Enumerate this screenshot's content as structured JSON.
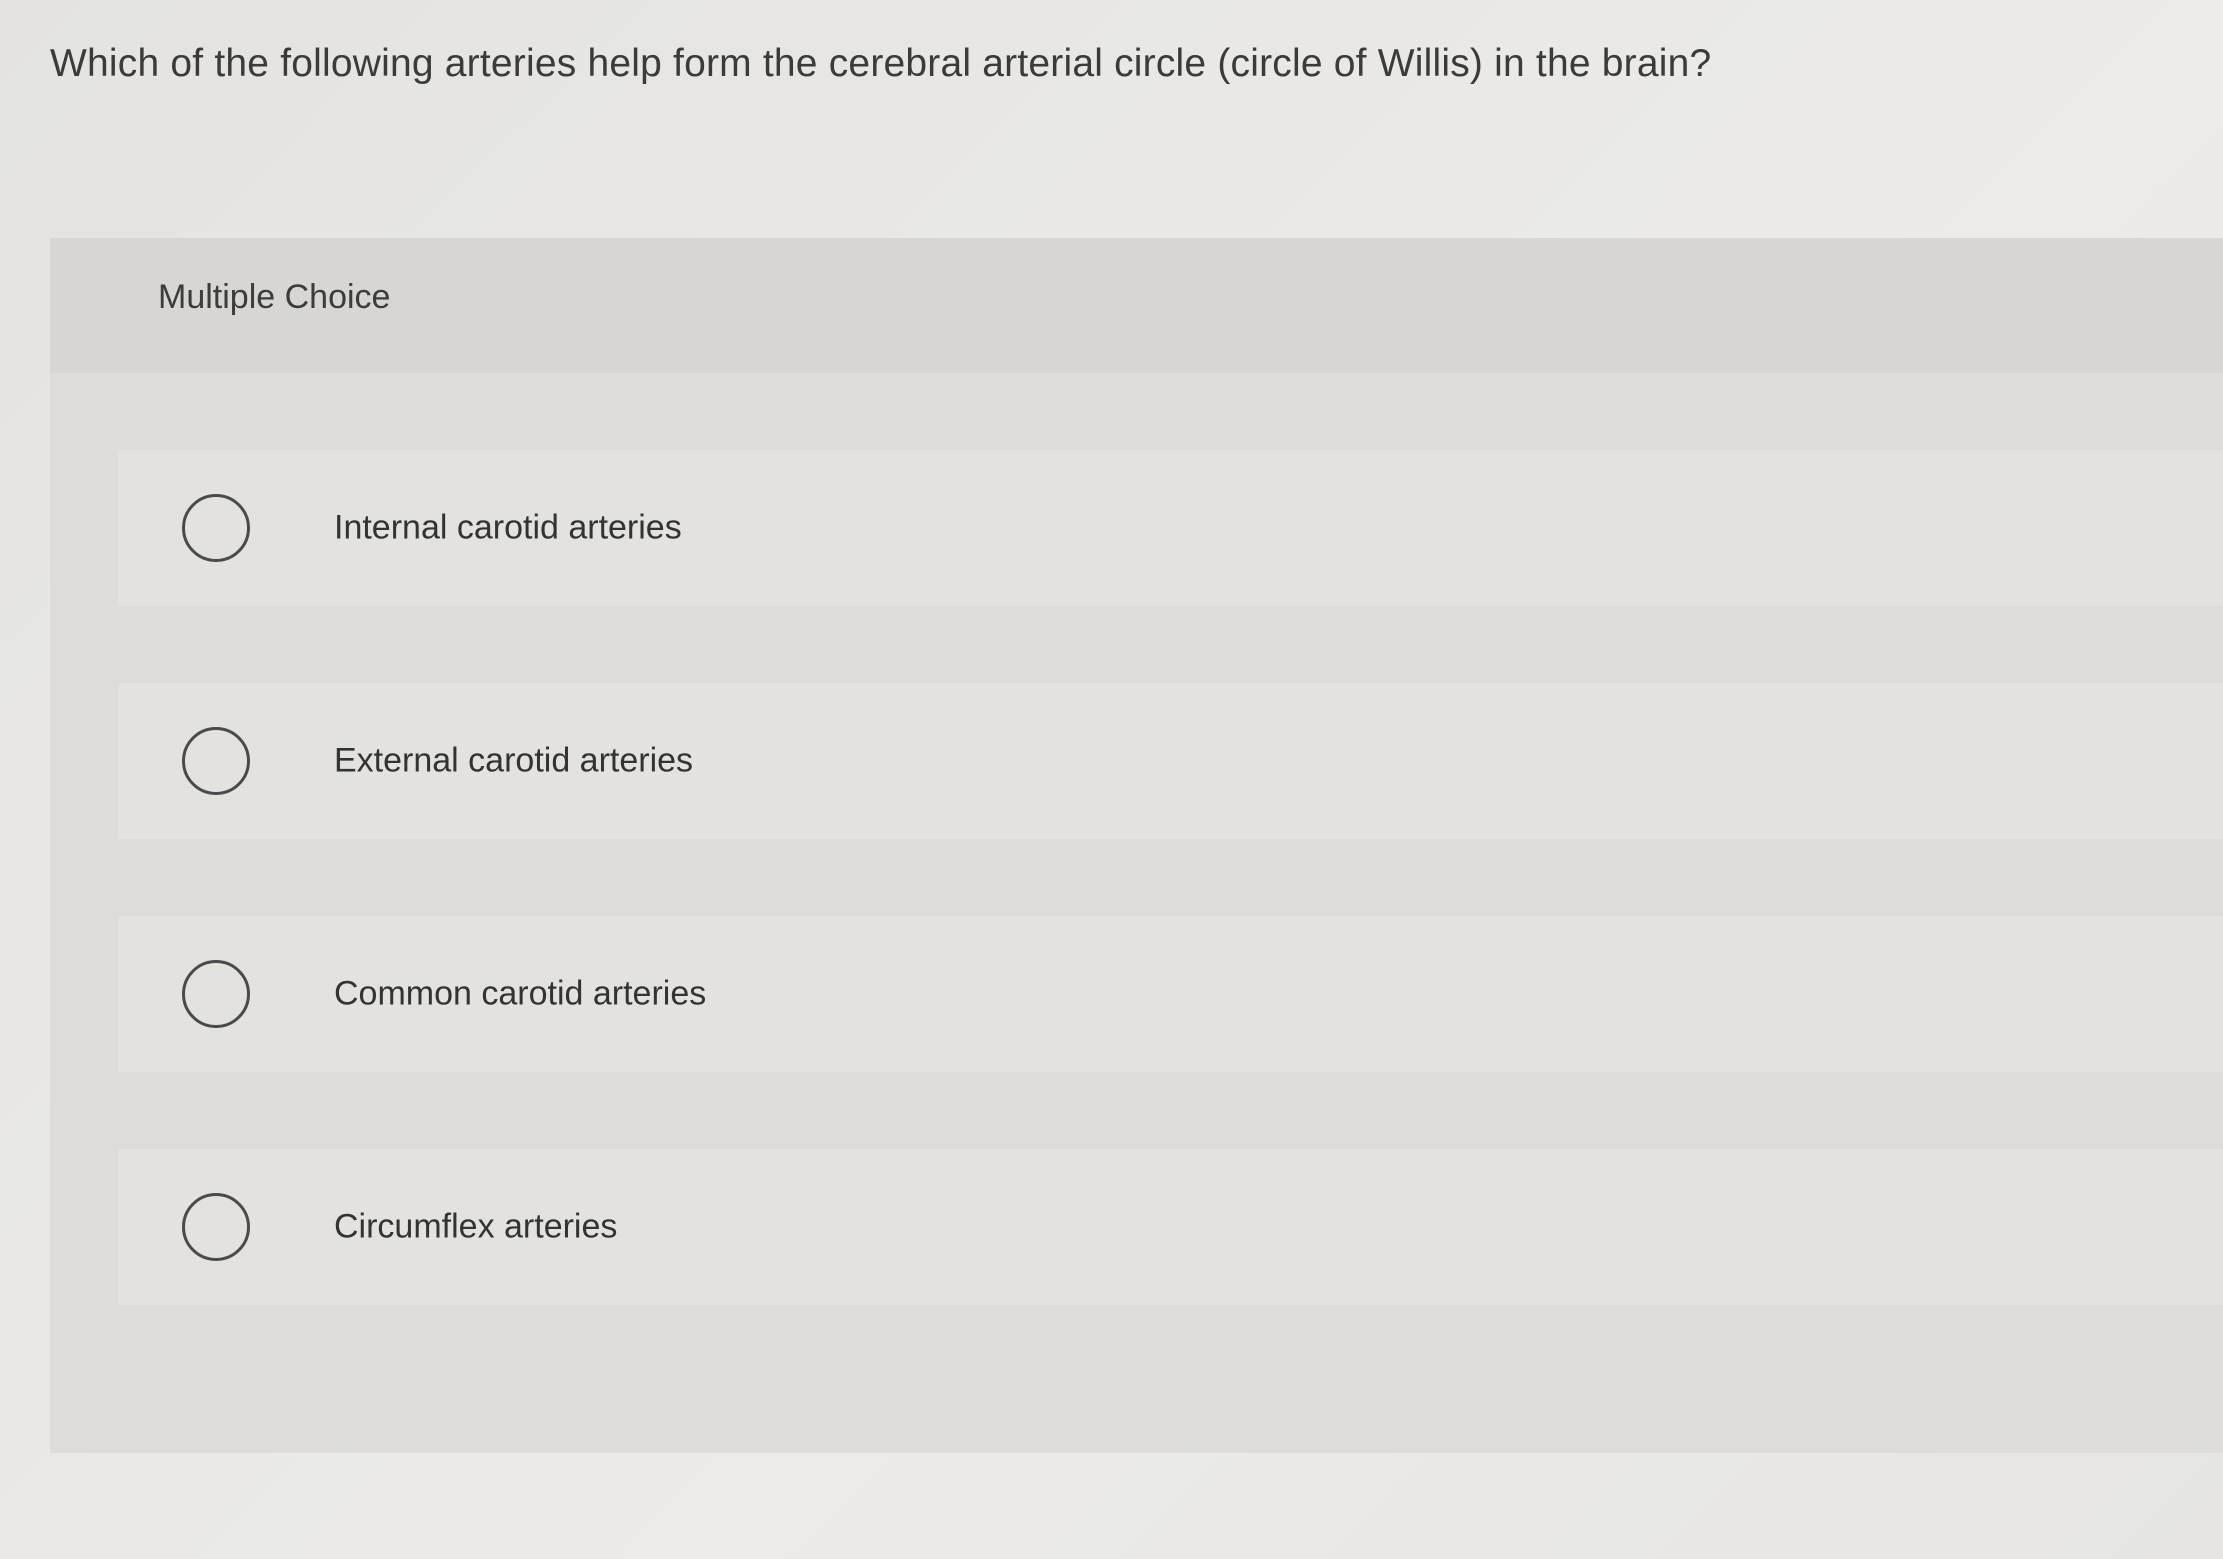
{
  "question": {
    "text": "Which of the following arteries help form the cerebral arterial circle (circle of Willis) in the brain?"
  },
  "multiple_choice": {
    "label": "Multiple Choice",
    "options": [
      {
        "label": "Internal carotid arteries",
        "selected": false
      },
      {
        "label": "External carotid arteries",
        "selected": false
      },
      {
        "label": "Common carotid arteries",
        "selected": false
      },
      {
        "label": "Circumflex arteries",
        "selected": false
      }
    ]
  }
}
